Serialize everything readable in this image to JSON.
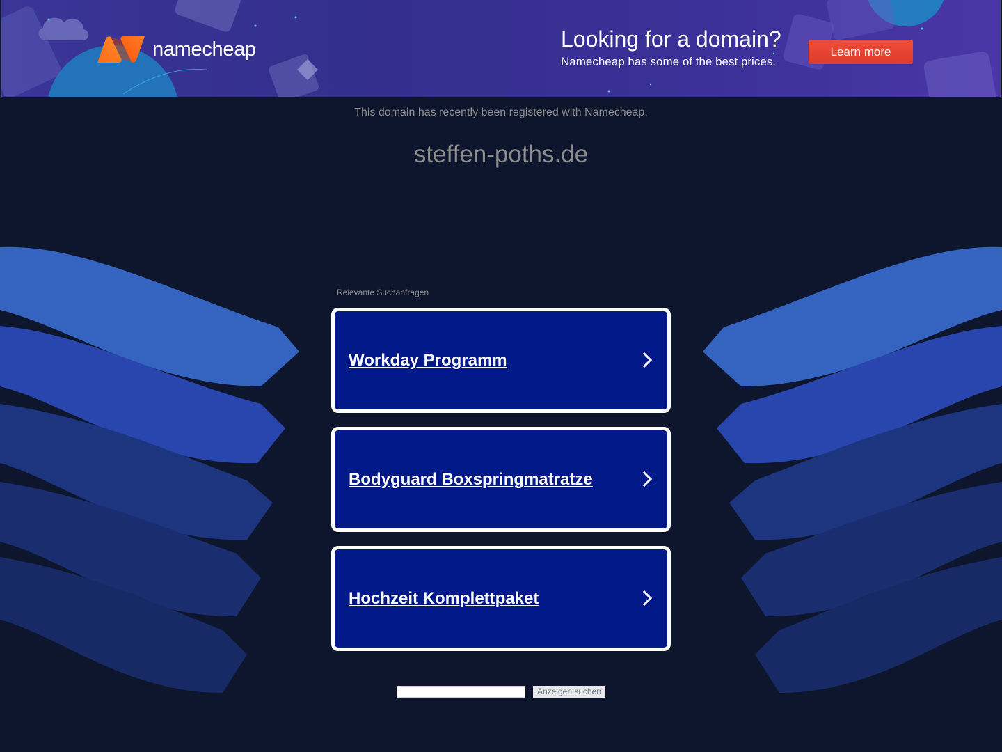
{
  "banner": {
    "logo_text": "namecheap",
    "title": "Looking for a domain?",
    "subtitle": "Namecheap has some of the best prices.",
    "cta_label": "Learn more"
  },
  "notice": "This domain has recently been registered with Namecheap.",
  "domain": "steffen-poths.de",
  "related": {
    "label": "Relevante Suchanfragen",
    "items": [
      {
        "label": "Workday Programm"
      },
      {
        "label": "Bodyguard Boxspringmatratze"
      },
      {
        "label": "Hochzeit Komplettpaket"
      }
    ]
  },
  "ad_search": {
    "input_value": "",
    "button_label": "Anzeigen suchen"
  },
  "colors": {
    "page_background": "#0d162c",
    "banner_background": "#3a3597",
    "cta_button": "#e8432f",
    "card_background": "#02198a",
    "card_border": "#ffffff",
    "wave_light": "#3463c0",
    "wave_mid": "#2342a6",
    "wave_dark": "#182e6e",
    "muted_text": "#8c8c8c"
  },
  "icons": {
    "logo": "namecheap-logo-icon",
    "chevron": "chevron-right-icon"
  }
}
